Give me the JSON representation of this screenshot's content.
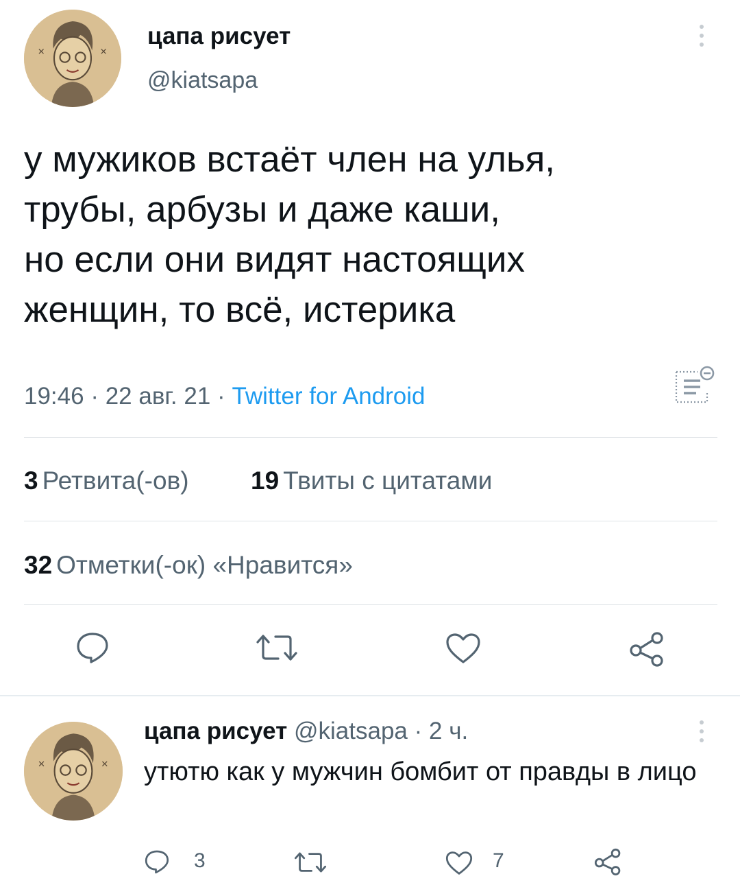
{
  "tweet": {
    "author": {
      "name": "цапа рисует",
      "handle": "@kiatsapa"
    },
    "lines": [
      "у мужиков встаёт член на улья,",
      "трубы, арбузы и даже каши,",
      "но если они видят настоящих",
      "женщин, то всё, истерика"
    ],
    "time": "19:46",
    "date": "22 авг. 21",
    "source": "Twitter for Android",
    "separator": "·",
    "stats": {
      "retweets_count": "3",
      "retweets_label": "Ретвита(-ов)",
      "quotes_count": "19",
      "quotes_label": "Твиты с цитатами",
      "likes_count": "32",
      "likes_label": "Отметки(-ок) «Нравится»"
    },
    "actions": [
      "reply-icon",
      "retweet-icon",
      "like-icon",
      "share-icon"
    ]
  },
  "reply": {
    "author": {
      "name": "цапа рисует",
      "handle": "@kiatsapa"
    },
    "time_ago": "2 ч.",
    "separator": "·",
    "text": "утютю как у мужчин бомбит от правды в лицо",
    "counts": {
      "replies": "3",
      "likes": "7"
    }
  },
  "colors": {
    "text": "#0f1419",
    "secondary": "#536471",
    "link": "#1d9bf0",
    "divider": "#dfe3e6"
  }
}
